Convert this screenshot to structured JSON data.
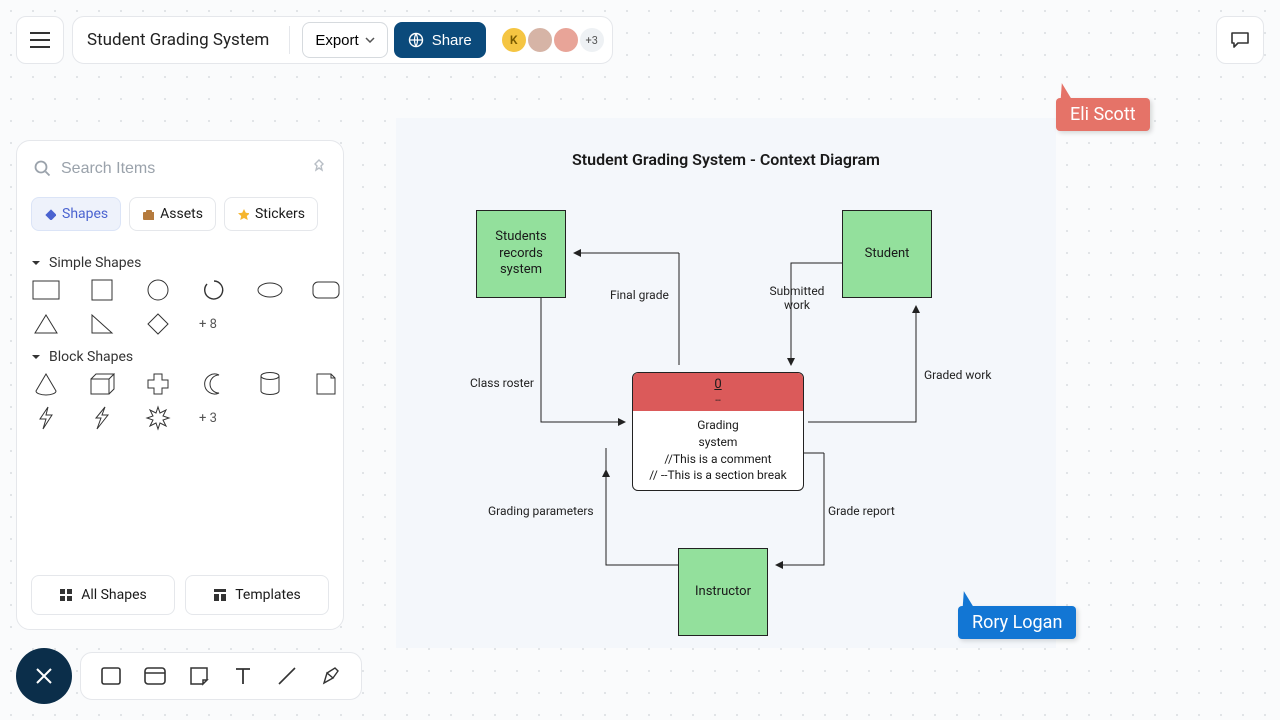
{
  "header": {
    "title": "Student Grading System",
    "export": "Export",
    "share": "Share",
    "avatar1": "K",
    "avatar_count": "+3"
  },
  "panel": {
    "search_placeholder": "Search Items",
    "tabs": {
      "shapes": "Shapes",
      "assets": "Assets",
      "stickers": "Stickers"
    },
    "section_simple": "Simple Shapes",
    "simple_more": "+ 8",
    "section_block": "Block Shapes",
    "block_more": "+ 3",
    "all_shapes": "All Shapes",
    "templates": "Templates"
  },
  "diagram": {
    "title": "Student Grading System - Context Diagram",
    "nodes": {
      "records": "Students records system",
      "student": "Student",
      "instructor": "Instructor"
    },
    "center": {
      "head": "0",
      "line1": "Grading",
      "line2": "system",
      "line3": "//This is a comment",
      "line4": "// --This is a section break"
    },
    "edges": {
      "final_grade": "Final grade",
      "class_roster": "Class roster",
      "submitted_work": "Submitted work",
      "graded_work": "Graded work",
      "grading_params": "Grading parameters",
      "grade_report": "Grade report"
    }
  },
  "cursors": {
    "eli": "Eli Scott",
    "rory": "Rory Logan"
  }
}
